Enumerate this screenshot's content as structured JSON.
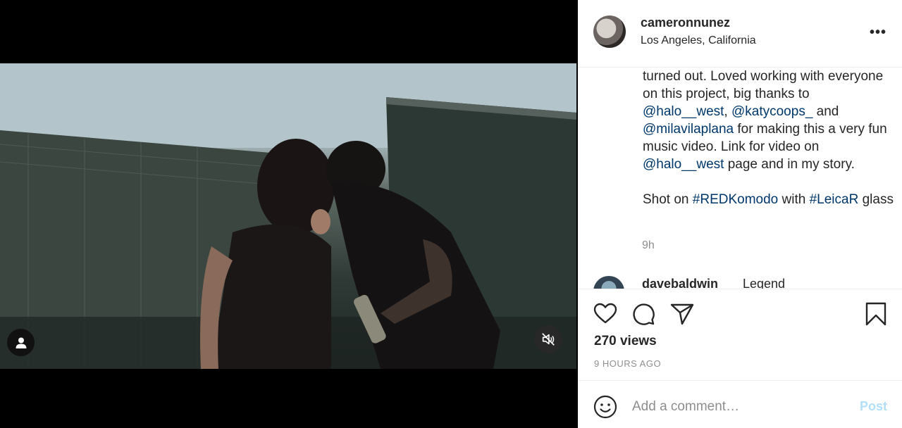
{
  "post": {
    "username": "cameronnunez",
    "location": "Los Angeles, California",
    "more_label": "•••",
    "caption": {
      "line1_text": "turned out. Loved working with everyone on this project, big thanks to ",
      "mention1": "@halo__west",
      "sep1": ", ",
      "mention2": "@katycoops_",
      "sep2": " and ",
      "mention3": "@milavilaplana",
      "line2_text": " for making this a very fun music video. Link for video on ",
      "mention4": "@halo__west",
      "line3_text": " page and in my story.",
      "shot_prefix": "Shot on ",
      "hashtag1": "#REDKomodo",
      "shot_mid": " with ",
      "hashtag2": "#LeicaR",
      "shot_suffix": " glass"
    },
    "time_ago": "9h",
    "comments": [
      {
        "username": "davebaldwin",
        "text": "Legend"
      }
    ],
    "views": "270 views",
    "posted": "9 HOURS AGO",
    "add_comment_placeholder": "Add a comment…",
    "post_button": "Post"
  },
  "icons": {
    "user_tag": "person-icon",
    "mute": "speaker-muted-icon",
    "like": "heart-icon",
    "comment": "comment-bubble-icon",
    "share": "paper-plane-icon",
    "save": "bookmark-icon",
    "emoji": "smiley-icon"
  },
  "colors": {
    "mention": "#00376b",
    "muted_text": "#8e8e8e",
    "post_button_disabled": "#b2dffc"
  }
}
